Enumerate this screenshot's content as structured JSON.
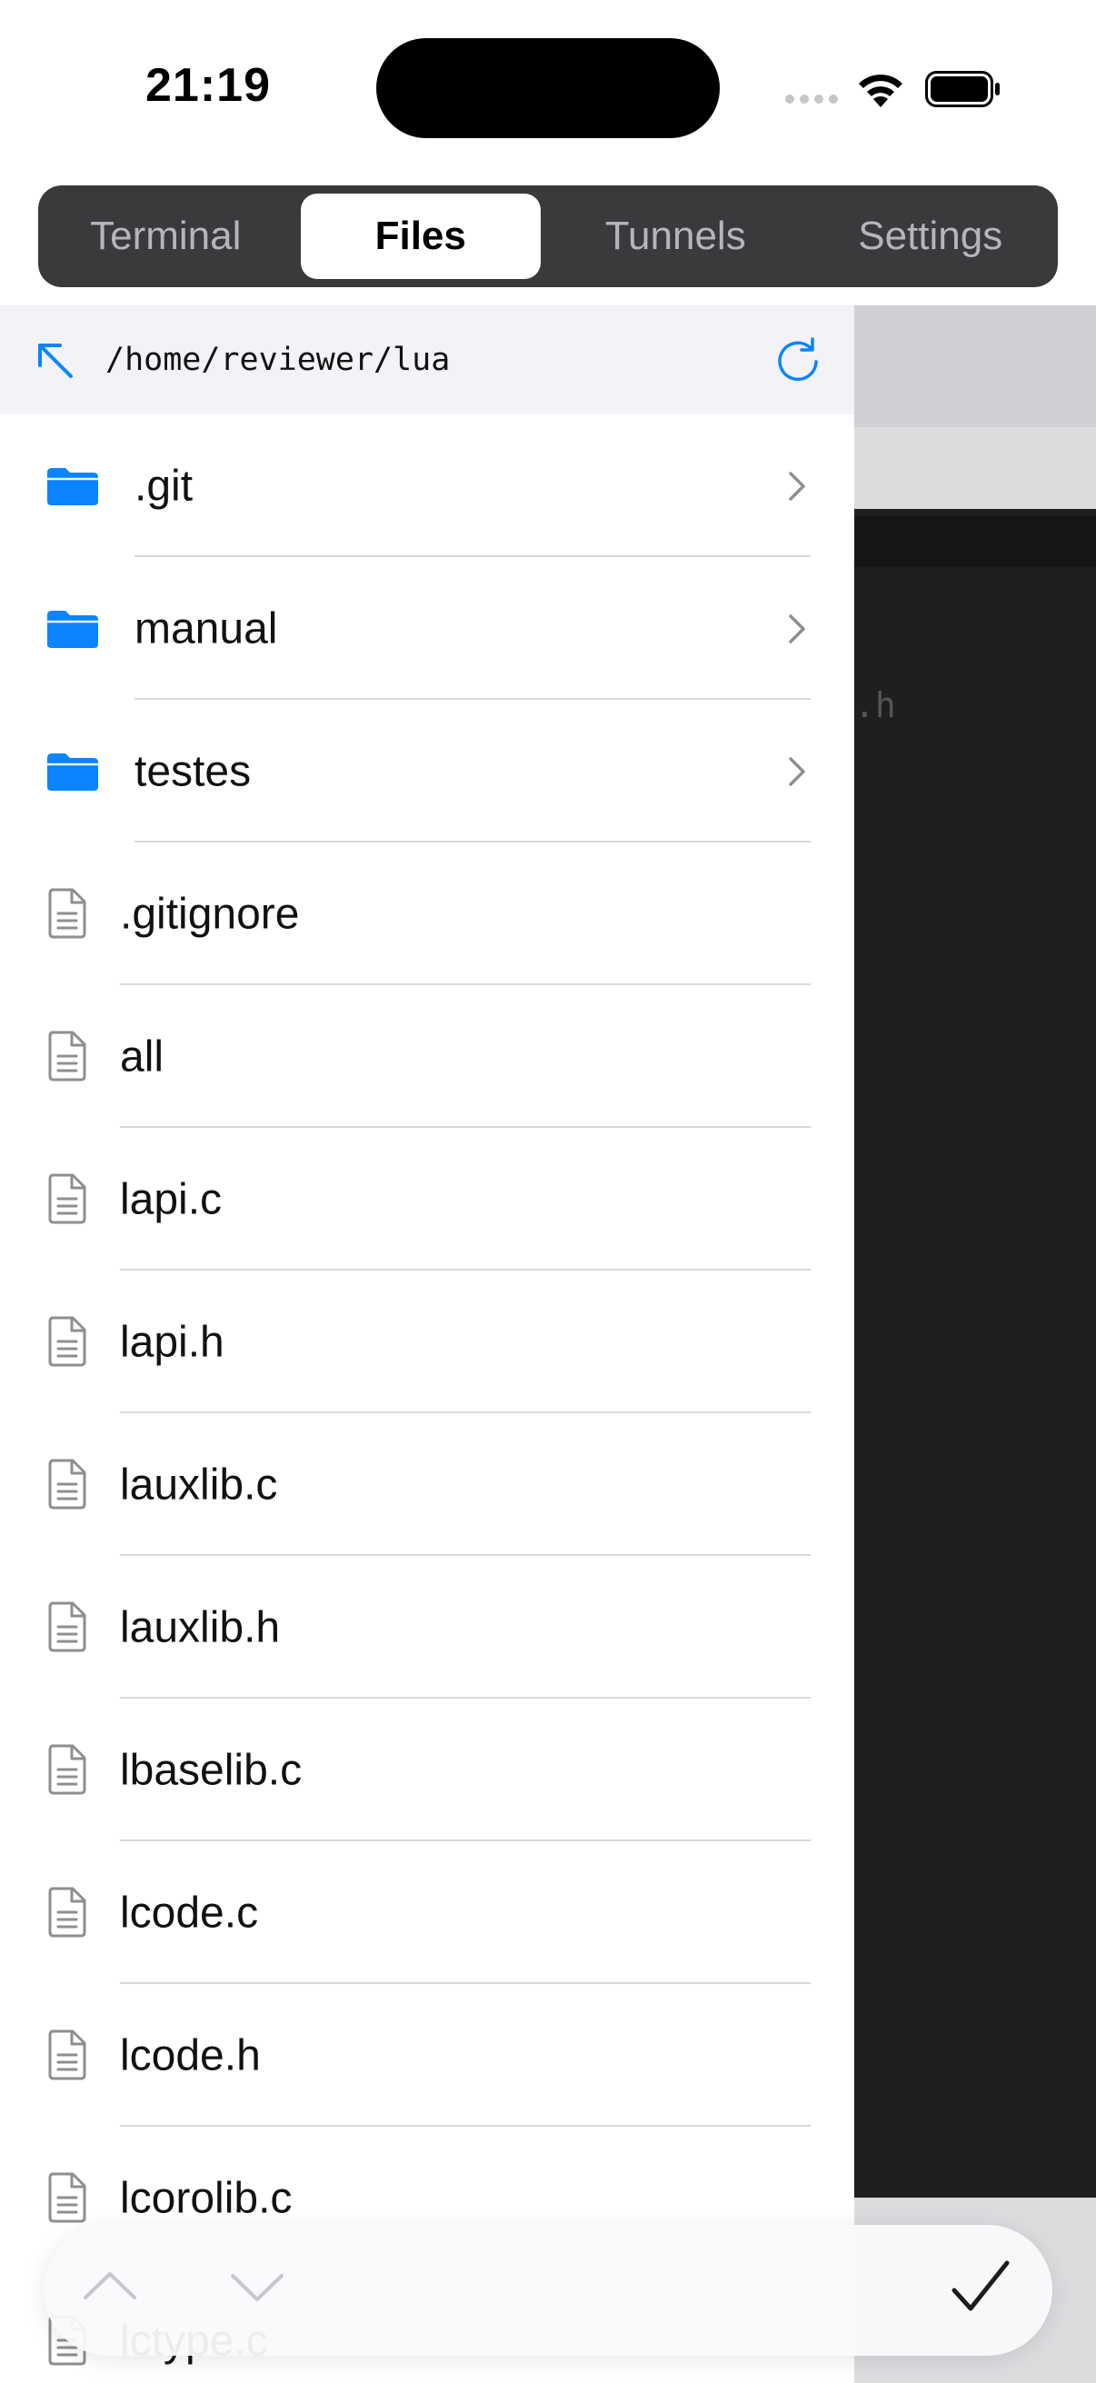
{
  "status_bar": {
    "time": "21:19",
    "icons": [
      "cellular-signal-icon",
      "wifi-icon",
      "battery-icon"
    ]
  },
  "tabs": [
    {
      "label": "Terminal",
      "active": false
    },
    {
      "label": "Files",
      "active": true
    },
    {
      "label": "Tunnels",
      "active": false
    },
    {
      "label": "Settings",
      "active": false
    }
  ],
  "path_bar": {
    "path": "/home/reviewer/lua",
    "up_icon": "arrow-up-left-icon",
    "refresh_icon": "refresh-icon"
  },
  "files": [
    {
      "name": ".git",
      "type": "folder"
    },
    {
      "name": "manual",
      "type": "folder"
    },
    {
      "name": "testes",
      "type": "folder"
    },
    {
      "name": ".gitignore",
      "type": "file"
    },
    {
      "name": "all",
      "type": "file"
    },
    {
      "name": "lapi.c",
      "type": "file"
    },
    {
      "name": "lapi.h",
      "type": "file"
    },
    {
      "name": "lauxlib.c",
      "type": "file"
    },
    {
      "name": "lauxlib.h",
      "type": "file"
    },
    {
      "name": "lbaselib.c",
      "type": "file"
    },
    {
      "name": "lcode.c",
      "type": "file"
    },
    {
      "name": "lcode.h",
      "type": "file"
    },
    {
      "name": "lcorolib.c",
      "type": "file"
    },
    {
      "name": "lctype.c",
      "type": "file"
    }
  ],
  "background_pane": {
    "visible_text": ".h"
  },
  "toolbar": {
    "icons": [
      "chevron-up-icon",
      "chevron-down-icon",
      "checkmark-icon"
    ]
  },
  "colors": {
    "accent": "#0a84ff",
    "folder": "#0a84ff",
    "tabs_bg": "#3a3a3c",
    "path_bar_bg": "#f2f2f7"
  }
}
